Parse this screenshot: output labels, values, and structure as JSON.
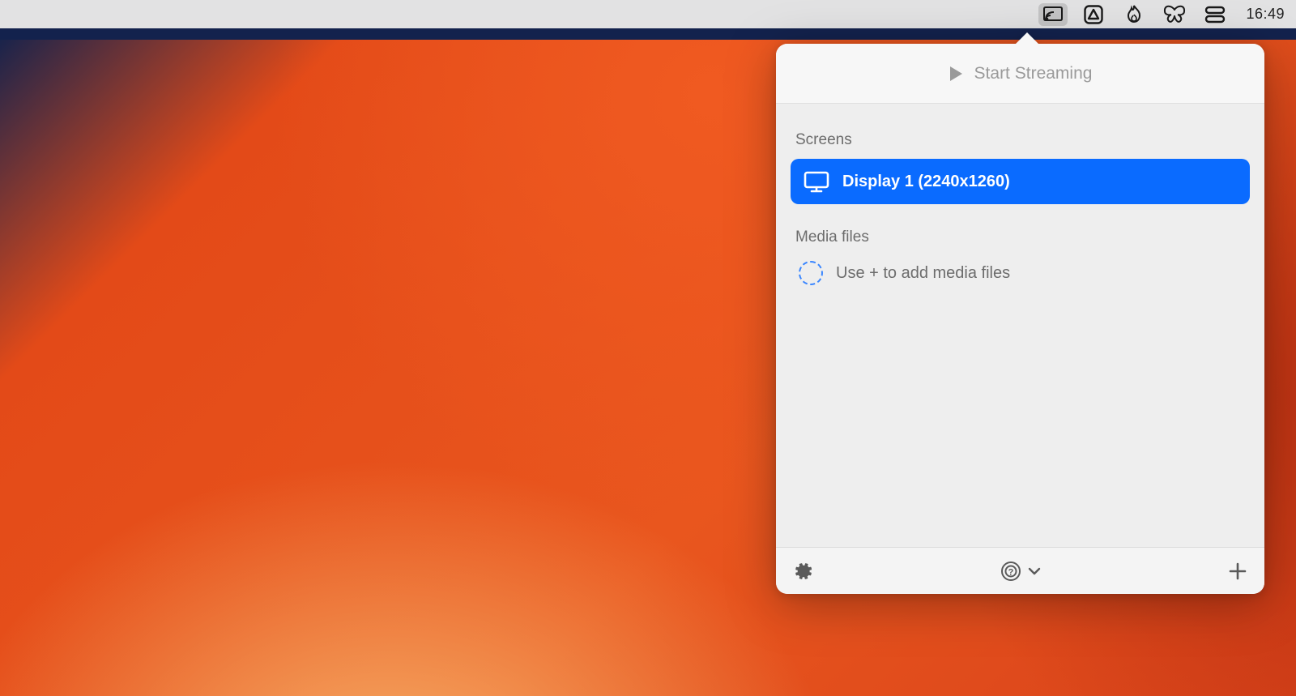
{
  "menubar": {
    "clock": "16:49"
  },
  "popover": {
    "header": {
      "start_streaming_label": "Start Streaming"
    },
    "sections": {
      "screens_label": "Screens",
      "media_files_label": "Media files"
    },
    "screens": [
      {
        "label": "Display 1 (2240x1260)"
      }
    ],
    "media": {
      "placeholder": "Use + to add media files"
    }
  }
}
